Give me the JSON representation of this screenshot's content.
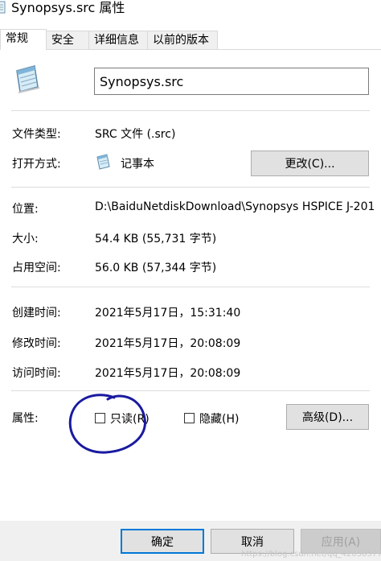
{
  "window": {
    "title": "Synopsys.src 属性",
    "title_icon": "notepad-file-icon"
  },
  "tabs": [
    {
      "label": "常规",
      "active": true
    },
    {
      "label": "安全",
      "active": false
    },
    {
      "label": "详细信息",
      "active": false
    },
    {
      "label": "以前的版本",
      "active": false
    }
  ],
  "general": {
    "file_icon": "notepad-file-icon",
    "filename": "Synopsys.src",
    "type_label": "文件类型:",
    "type_value": "SRC 文件 (.src)",
    "opens_with_label": "打开方式:",
    "opens_with_icon": "notepad-icon",
    "opens_with_value": "记事本",
    "change_button": "更改(C)...",
    "location_label": "位置:",
    "location_value": "D:\\BaiduNetdiskDownload\\Synopsys HSPICE J-201",
    "size_label": "大小:",
    "size_value": "54.4 KB (55,731 字节)",
    "size_on_disk_label": "占用空间:",
    "size_on_disk_value": "56.0 KB (57,344 字节)",
    "created_label": "创建时间:",
    "created_value": "2021年5月17日，15:31:40",
    "modified_label": "修改时间:",
    "modified_value": "2021年5月17日，20:08:09",
    "accessed_label": "访问时间:",
    "accessed_value": "2021年5月17日，20:08:09",
    "attributes_label": "属性:",
    "readonly_label": "只读(R)",
    "readonly_checked": false,
    "hidden_label": "隐藏(H)",
    "hidden_checked": false,
    "advanced_button": "高级(D)..."
  },
  "footer": {
    "ok_button": "确定",
    "cancel_button": "取消",
    "apply_button": "应用(A)"
  },
  "annotation": {
    "color": "#1a1aa0"
  },
  "watermark": "https://blog.csdn.net/qq_42058577"
}
